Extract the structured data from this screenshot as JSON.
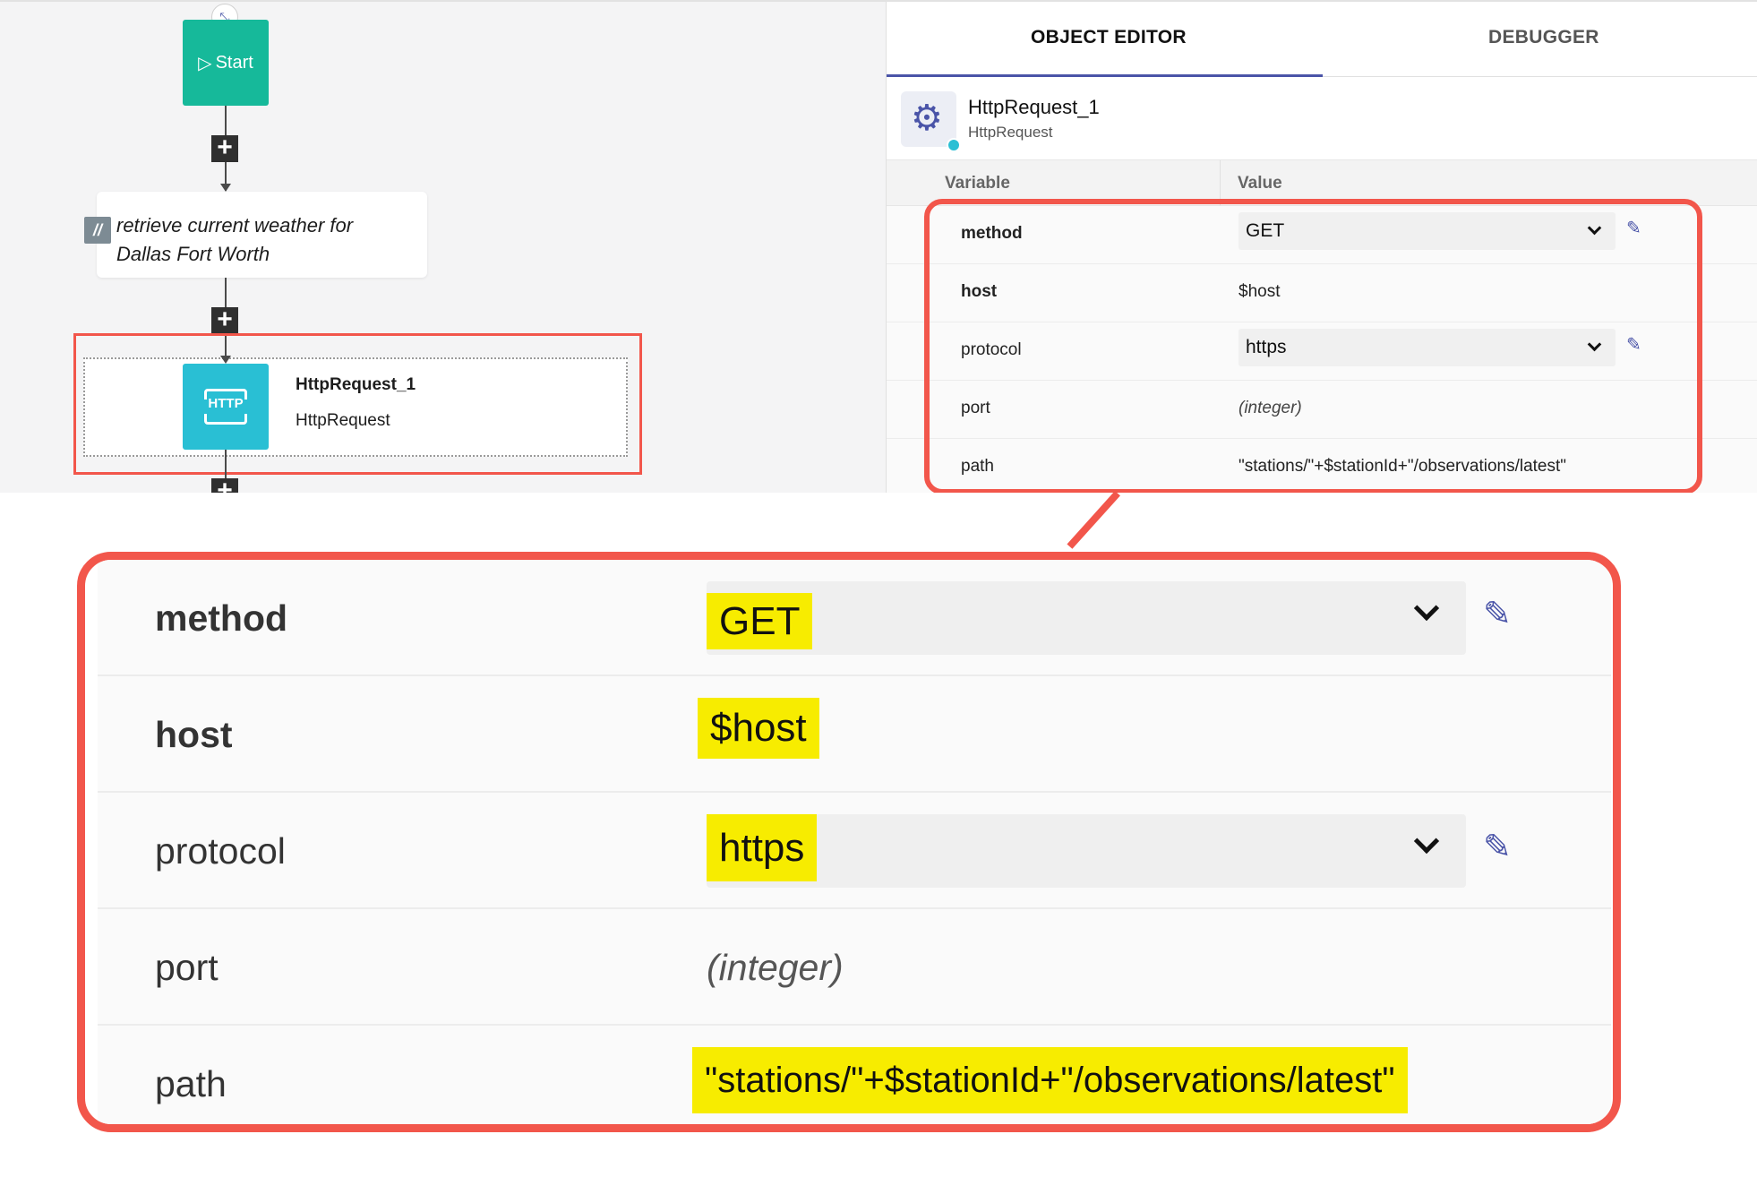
{
  "canvas": {
    "start_label": "Start",
    "comment_badge": "//",
    "comment_text": "retrieve current weather for Dallas Fort Worth",
    "expand_glyph": "⤡",
    "plus_glyph": "+",
    "http_node": {
      "icon_label": "HTTP",
      "title": "HttpRequest_1",
      "subtitle": "HttpRequest"
    }
  },
  "panel": {
    "tabs": [
      {
        "label": "OBJECT EDITOR",
        "active": true
      },
      {
        "label": "DEBUGGER",
        "active": false
      }
    ],
    "object": {
      "name": "HttpRequest_1",
      "type": "HttpRequest"
    },
    "table": {
      "col_variable": "Variable",
      "col_value": "Value",
      "rows": [
        {
          "variable": "method",
          "value": "GET",
          "kind": "select"
        },
        {
          "variable": "host",
          "value": "$host",
          "kind": "text"
        },
        {
          "variable": "protocol",
          "value": "https",
          "kind": "select"
        },
        {
          "variable": "port",
          "value": "(integer)",
          "kind": "placeholder"
        },
        {
          "variable": "path",
          "value": "\"stations/\"+$stationId+\"/observations/latest\"",
          "kind": "text"
        }
      ]
    }
  },
  "colors": {
    "highlight_red": "#f2564b",
    "highlight_yellow": "#f7ec00",
    "accent": "#4a54a8",
    "start_green": "#16b99a",
    "http_cyan": "#29bfd4"
  }
}
